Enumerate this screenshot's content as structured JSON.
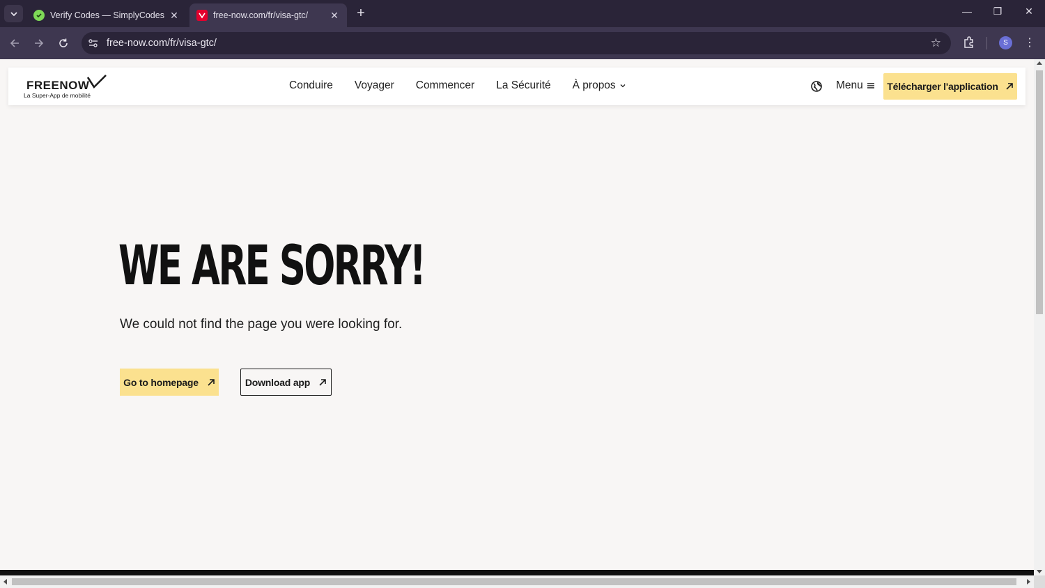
{
  "browser": {
    "tabs": [
      {
        "title": "Verify Codes — SimplyCodes",
        "icon": "simplycodes-favicon",
        "active": false
      },
      {
        "title": "free-now.com/fr/visa-gtc/",
        "icon": "freenow-favicon",
        "active": true
      }
    ],
    "url": "free-now.com/fr/visa-gtc/",
    "profile_initial": "S"
  },
  "site": {
    "logo": {
      "wordmark": "FREENOW",
      "tagline": "La Super-App de mobilité"
    },
    "nav": [
      {
        "label": "Conduire"
      },
      {
        "label": "Voyager"
      },
      {
        "label": "Commencer"
      },
      {
        "label": "La Sécurité"
      },
      {
        "label": "À propos",
        "has_dropdown": true
      }
    ],
    "menu_label": "Menu",
    "cta_label": "Télécharger l'application"
  },
  "error_page": {
    "title": "WE ARE SORRY!",
    "subtitle": "We could not find the page you were looking for.",
    "home_button": "Go to homepage",
    "download_button": "Download app"
  },
  "colors": {
    "accent_yellow": "#fbe18f",
    "page_background": "#f8f6f5",
    "chrome_dark": "#2a2438",
    "chrome_toolbar": "#3e3750"
  }
}
